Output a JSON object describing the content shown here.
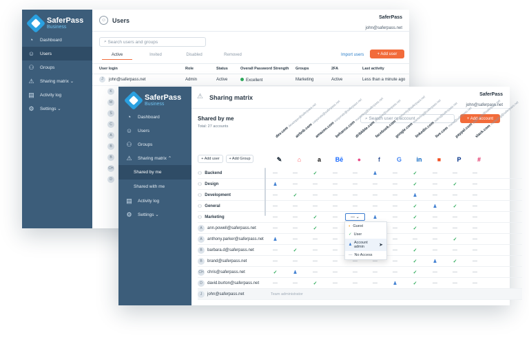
{
  "brand": {
    "name": "SaferPass",
    "tier": "Business"
  },
  "company": {
    "name": "SaferPass",
    "email": "john@saferpass.net"
  },
  "back_window": {
    "title": "Users",
    "search_placeholder": "Search users and groups",
    "tabs": [
      "Active",
      "Invited",
      "Disabled",
      "Removed"
    ],
    "import_label": "Import users",
    "add_label": "+ Add user",
    "columns": [
      "User login",
      "Role",
      "Status",
      "Overall Password Strength",
      "Groups",
      "2FA",
      "Last activity"
    ],
    "row": {
      "login": "john@saferpass.net",
      "role": "Admin",
      "status": "Active",
      "strength": "Excellent",
      "groups": "Marketing",
      "twofa": "Active",
      "last": "Less than a minute ago"
    },
    "avatars": [
      "J",
      "K",
      "M",
      "S",
      "C",
      "A",
      "B",
      "B",
      "CH",
      "D"
    ],
    "nav": [
      {
        "label": "Dashboard",
        "icon": "gauge-icon"
      },
      {
        "label": "Users",
        "icon": "user-icon"
      },
      {
        "label": "Groups",
        "icon": "group-icon"
      },
      {
        "label": "Sharing matrix ⌄",
        "icon": "share-icon"
      },
      {
        "label": "Activity log",
        "icon": "log-icon"
      },
      {
        "label": "Settings ⌄",
        "icon": "gear-icon"
      }
    ]
  },
  "front_window": {
    "title": "Sharing matrix",
    "heading": "Shared by me",
    "total": "Total: 27 accounts",
    "search_placeholder": "Search user or account",
    "add_account": "+ Add account",
    "add_user": "+ Add user",
    "add_group": "+ Add Group",
    "nav": [
      {
        "label": "Dashboard"
      },
      {
        "label": "Users"
      },
      {
        "label": "Groups"
      },
      {
        "label": "Sharing matrix ⌃"
      },
      {
        "label": "Shared by me"
      },
      {
        "label": "Shared with me"
      },
      {
        "label": "Activity log"
      },
      {
        "label": "Settings ⌄"
      }
    ],
    "services": [
      "dev.com",
      "airbnb.com",
      "amazon.com",
      "behance.com",
      "dribbble.com",
      "facebook.com",
      "google.com",
      "linkedin.com",
      "live.com",
      "paypal.com",
      "slack.com"
    ],
    "service_emails": [
      "developer@saferpass.net",
      "corporate@saferpass.net",
      "corporate@saferpass.net",
      "marketing@saferpass.net",
      "creative@saferpass.net",
      "community@saferpass.net",
      "marketing@saferpass.net",
      "sales@saferpass.net",
      "maria@saferpass.net",
      "payments@saferpass.net",
      "marketing@saferpass.net"
    ],
    "rows": [
      {
        "label": "Backend",
        "type": "group",
        "cells": [
          "—",
          "—",
          "ok",
          "—",
          "—",
          "user",
          "—",
          "ok",
          "—",
          "—",
          "—"
        ]
      },
      {
        "label": "Design",
        "type": "group",
        "cells": [
          "user",
          "—",
          "—",
          "—",
          "—",
          "—",
          "—",
          "ok",
          "—",
          "ok",
          "—"
        ]
      },
      {
        "label": "Development",
        "type": "group",
        "cells": [
          "—",
          "ok",
          "—",
          "—",
          "—",
          "—",
          "—",
          "user",
          "—",
          "—",
          "—"
        ]
      },
      {
        "label": "General",
        "type": "group",
        "cells": [
          "—",
          "—",
          "—",
          "—",
          "—",
          "—",
          "—",
          "ok",
          "user",
          "ok",
          "—"
        ]
      },
      {
        "label": "Marketing",
        "type": "group",
        "cells": [
          "—",
          "—",
          "ok",
          "—",
          "sel",
          "user",
          "—",
          "ok",
          "—",
          "—",
          "—"
        ]
      },
      {
        "label": "ann.powell@saferpass.net",
        "type": "user",
        "avatar": "A",
        "cells": [
          "—",
          "—",
          "ok",
          "—",
          "",
          "",
          "—",
          "ok",
          "—",
          "—",
          "—"
        ]
      },
      {
        "label": "anthony.parker@saferpass.net",
        "type": "user",
        "avatar": "A",
        "cells": [
          "user",
          "—",
          "—",
          "—",
          "",
          "",
          "—",
          "—",
          "—",
          "ok",
          "—"
        ]
      },
      {
        "label": "barbara.d@saferpass.net",
        "type": "user",
        "avatar": "B",
        "cells": [
          "—",
          "ok",
          "—",
          "—",
          "",
          "",
          "—",
          "ok",
          "—",
          "—",
          "—"
        ]
      },
      {
        "label": "brand@saferpass.net",
        "type": "user",
        "avatar": "B",
        "cells": [
          "—",
          "—",
          "—",
          "—",
          "—",
          "—",
          "—",
          "ok",
          "user",
          "ok",
          "—"
        ]
      },
      {
        "label": "chris@saferpass.net",
        "type": "user",
        "avatar": "CH",
        "cells": [
          "ok",
          "user",
          "—",
          "—",
          "—",
          "—",
          "—",
          "ok",
          "—",
          "—",
          "—"
        ]
      },
      {
        "label": "david.burton@saferpass.net",
        "type": "user",
        "avatar": "D",
        "cells": [
          "—",
          "—",
          "ok",
          "—",
          "—",
          "—",
          "user",
          "ok",
          "—",
          "—",
          "—"
        ]
      },
      {
        "label": "john@saferpass.net",
        "type": "user",
        "avatar": "J",
        "note": "Team administrator"
      }
    ],
    "dropdown": [
      {
        "label": "Guest",
        "mark": "◐"
      },
      {
        "label": "User",
        "mark": "✓"
      },
      {
        "label": "Account admin",
        "mark": "♟"
      },
      {
        "label": "No Access",
        "mark": "—"
      }
    ],
    "dropdown_value": "— ⌄"
  }
}
